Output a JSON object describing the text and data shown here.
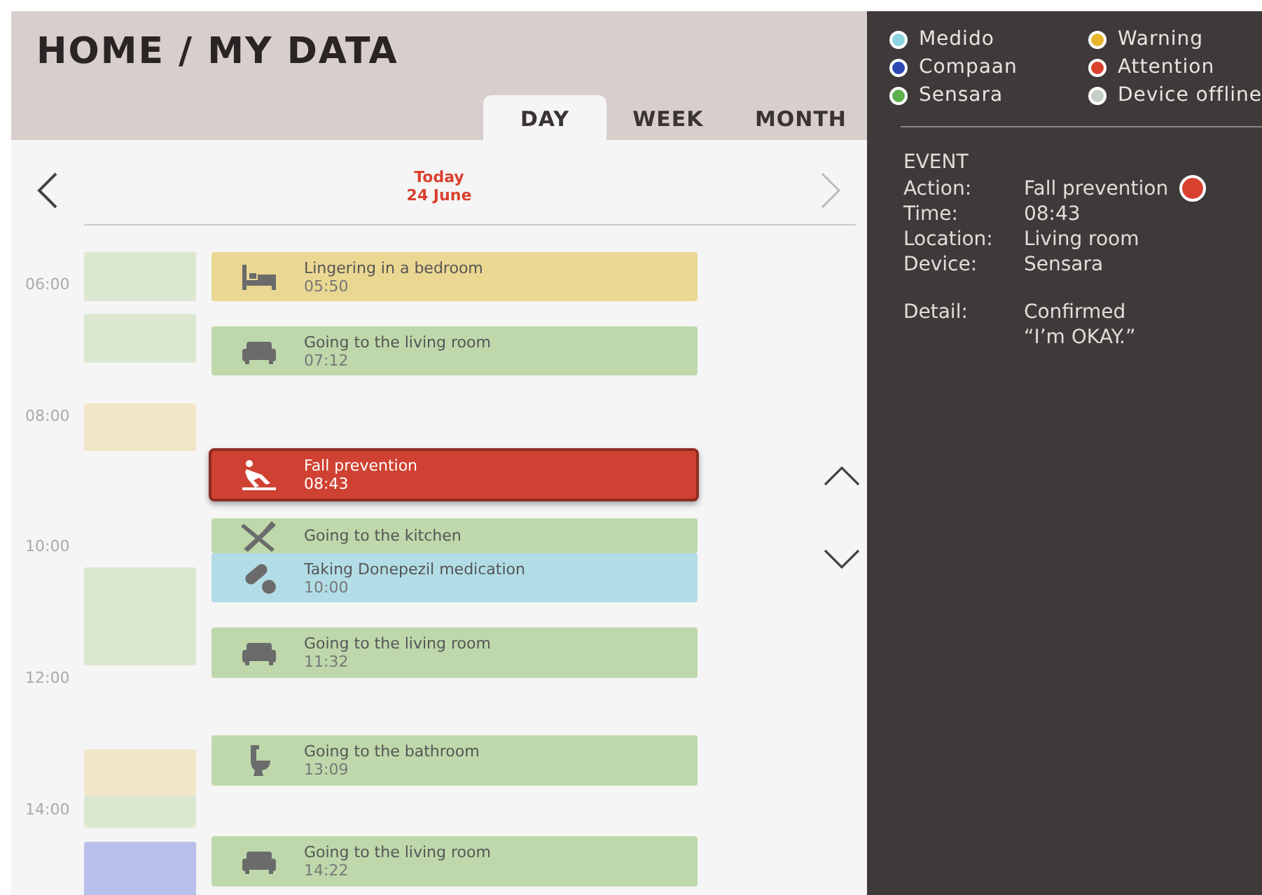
{
  "header": {
    "title": "HOME / MY DATA"
  },
  "tabs": [
    {
      "label": "DAY",
      "selected": true
    },
    {
      "label": "WEEK",
      "selected": false
    },
    {
      "label": "MONTH",
      "selected": false
    }
  ],
  "date": {
    "line1": "Today",
    "line2": "24 June"
  },
  "hours": [
    "06:00",
    "08:00",
    "10:00",
    "12:00",
    "14:00"
  ],
  "activity_blocks": [
    {
      "color": "#dce7d2"
    },
    {
      "color": "#dce7d2"
    },
    {
      "color": "#f1e6c7"
    },
    {
      "color": "#dce7d2"
    },
    {
      "color": "#f1e6c7"
    },
    {
      "color": "#dce7d2"
    },
    {
      "color": "#b8bfea"
    }
  ],
  "events": [
    {
      "kind": "bed",
      "title": "Lingering in a bedroom",
      "time": "05:50",
      "color": "#ead792",
      "selected": false
    },
    {
      "kind": "sofa",
      "title": "Going to the living room",
      "time": "07:12",
      "color": "#bed8ab",
      "selected": false
    },
    {
      "kind": "fall",
      "title": "Fall prevention",
      "time": "08:43",
      "color": "#cf4132",
      "selected": true
    },
    {
      "kind": "kitchen",
      "title": "Going to the kitchen",
      "color": "#bed8ab",
      "selected": false
    },
    {
      "kind": "pill",
      "title": "Taking Donepezil medication",
      "time": "10:00",
      "color": "#b2dde6",
      "selected": false
    },
    {
      "kind": "sofa",
      "title": "Going to the living room",
      "time": "11:32",
      "color": "#bed8ab",
      "selected": false
    },
    {
      "kind": "toilet",
      "title": "Going to the bathroom",
      "time": "13:09",
      "color": "#bed8ab",
      "selected": false
    },
    {
      "kind": "sofa",
      "title": "Going to the living room",
      "time": "14:22",
      "color": "#bed8ab",
      "selected": false
    }
  ],
  "legend": [
    {
      "label": "Medido",
      "color": "#8fd3e3"
    },
    {
      "label": "Warning",
      "color": "#e8b52c"
    },
    {
      "label": "Compaan",
      "color": "#2d49b3"
    },
    {
      "label": "Attention",
      "color": "#d9412f"
    },
    {
      "label": "Sensara",
      "color": "#5db04e"
    },
    {
      "label": "Device offline",
      "color": "#c6cfc6"
    }
  ],
  "event_detail": {
    "heading": "EVENT",
    "rows": [
      {
        "label": "Action:",
        "value": "Fall prevention",
        "color": "#d9412f"
      },
      {
        "label": "Time:",
        "value": "08:43"
      },
      {
        "label": "Location:",
        "value": "Living room"
      },
      {
        "label": "Device:",
        "value": "Sensara"
      }
    ],
    "detail_label": "Detail:",
    "detail_lines": [
      "Confirmed",
      "“I’m OKAY.”"
    ]
  }
}
